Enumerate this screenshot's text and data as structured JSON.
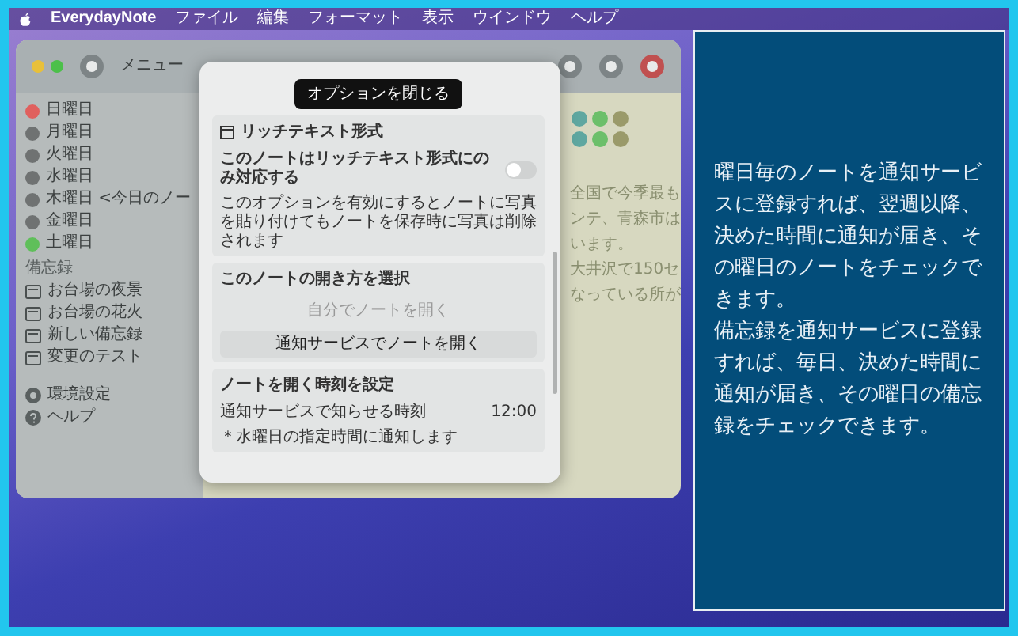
{
  "menu_bar": {
    "app_name": "EverydayNote",
    "items": [
      "ファイル",
      "編集",
      "フォーマット",
      "表示",
      "ウインドウ",
      "ヘルプ"
    ]
  },
  "app_window": {
    "toolbar_label": "メニュー",
    "sidebar": {
      "days": [
        {
          "label": "日曜日",
          "color": "#e0605e"
        },
        {
          "label": "月曜日",
          "color": "#6f7272"
        },
        {
          "label": "火曜日",
          "color": "#6f7272"
        },
        {
          "label": "水曜日",
          "color": "#6f7272"
        },
        {
          "label": "木曜日 <今日のノー",
          "color": "#6f7272"
        },
        {
          "label": "金曜日",
          "color": "#6f7272"
        },
        {
          "label": "土曜日",
          "color": "#5fbf5a"
        }
      ],
      "memo_header": "備忘録",
      "memos": [
        "お台場の夜景",
        "お台場の花火",
        "新しい備忘録",
        "変更のテスト"
      ],
      "bottom": [
        {
          "label": "環境設定",
          "kind": "gear"
        },
        {
          "label": "ヘルプ",
          "kind": "help"
        }
      ]
    },
    "note_lines": [
      "全国で今季最も",
      "ンテ、青森市は",
      "います。",
      "大井沢で150セ",
      "なっている所が"
    ],
    "sheet": {
      "close_button": "オプションを閉じる",
      "rich_text": {
        "title": "リッチテキスト形式",
        "option_label": "このノートはリッチテキスト形式にのみ対応する",
        "on": false,
        "note": "このオプションを有効にするとノートに写真を貼り付けてもノートを保存時に写真は削除されます"
      },
      "open_method": {
        "title": "このノートの開き方を選択",
        "options": [
          {
            "label": "自分でノートを開く",
            "selected": false
          },
          {
            "label": "通知サービスでノートを開く",
            "selected": true
          }
        ]
      },
      "time": {
        "title": "ノートを開く時刻を設定",
        "label": "通知サービスで知らせる時刻",
        "value": "12:00",
        "note": "＊水曜日の指定時間に通知します"
      }
    }
  },
  "description": {
    "paragraphs": [
      "曜日毎のノートを通知サービスに登録すれば、翌週以降、決めた時間に通知が届き、その曜日のノートをチェックできます。",
      "備忘録を通知サービスに登録すれば、毎日、決めた時間に通知が届き、その曜日の備忘録をチェックできます。"
    ]
  }
}
